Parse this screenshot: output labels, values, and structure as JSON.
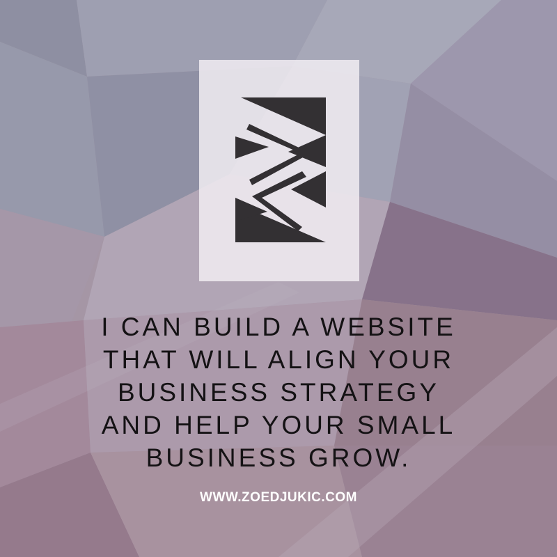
{
  "headline": {
    "lines": [
      "I CAN BUILD A WEBSITE",
      "THAT WILL ALIGN YOUR",
      "BUSINESS STRATEGY",
      "AND HELP YOUR SMALL",
      "BUSINESS GROW."
    ]
  },
  "website": "WWW.ZOEDJUKIC.COM",
  "logo": {
    "icon": "zd-monogram-icon",
    "card_color": "#efeaf0",
    "mark_color": "#333033"
  },
  "colors": {
    "slate": "#9b9bab",
    "mauve": "#a08a98",
    "text": "#141214",
    "url_text": "#ffffff"
  }
}
